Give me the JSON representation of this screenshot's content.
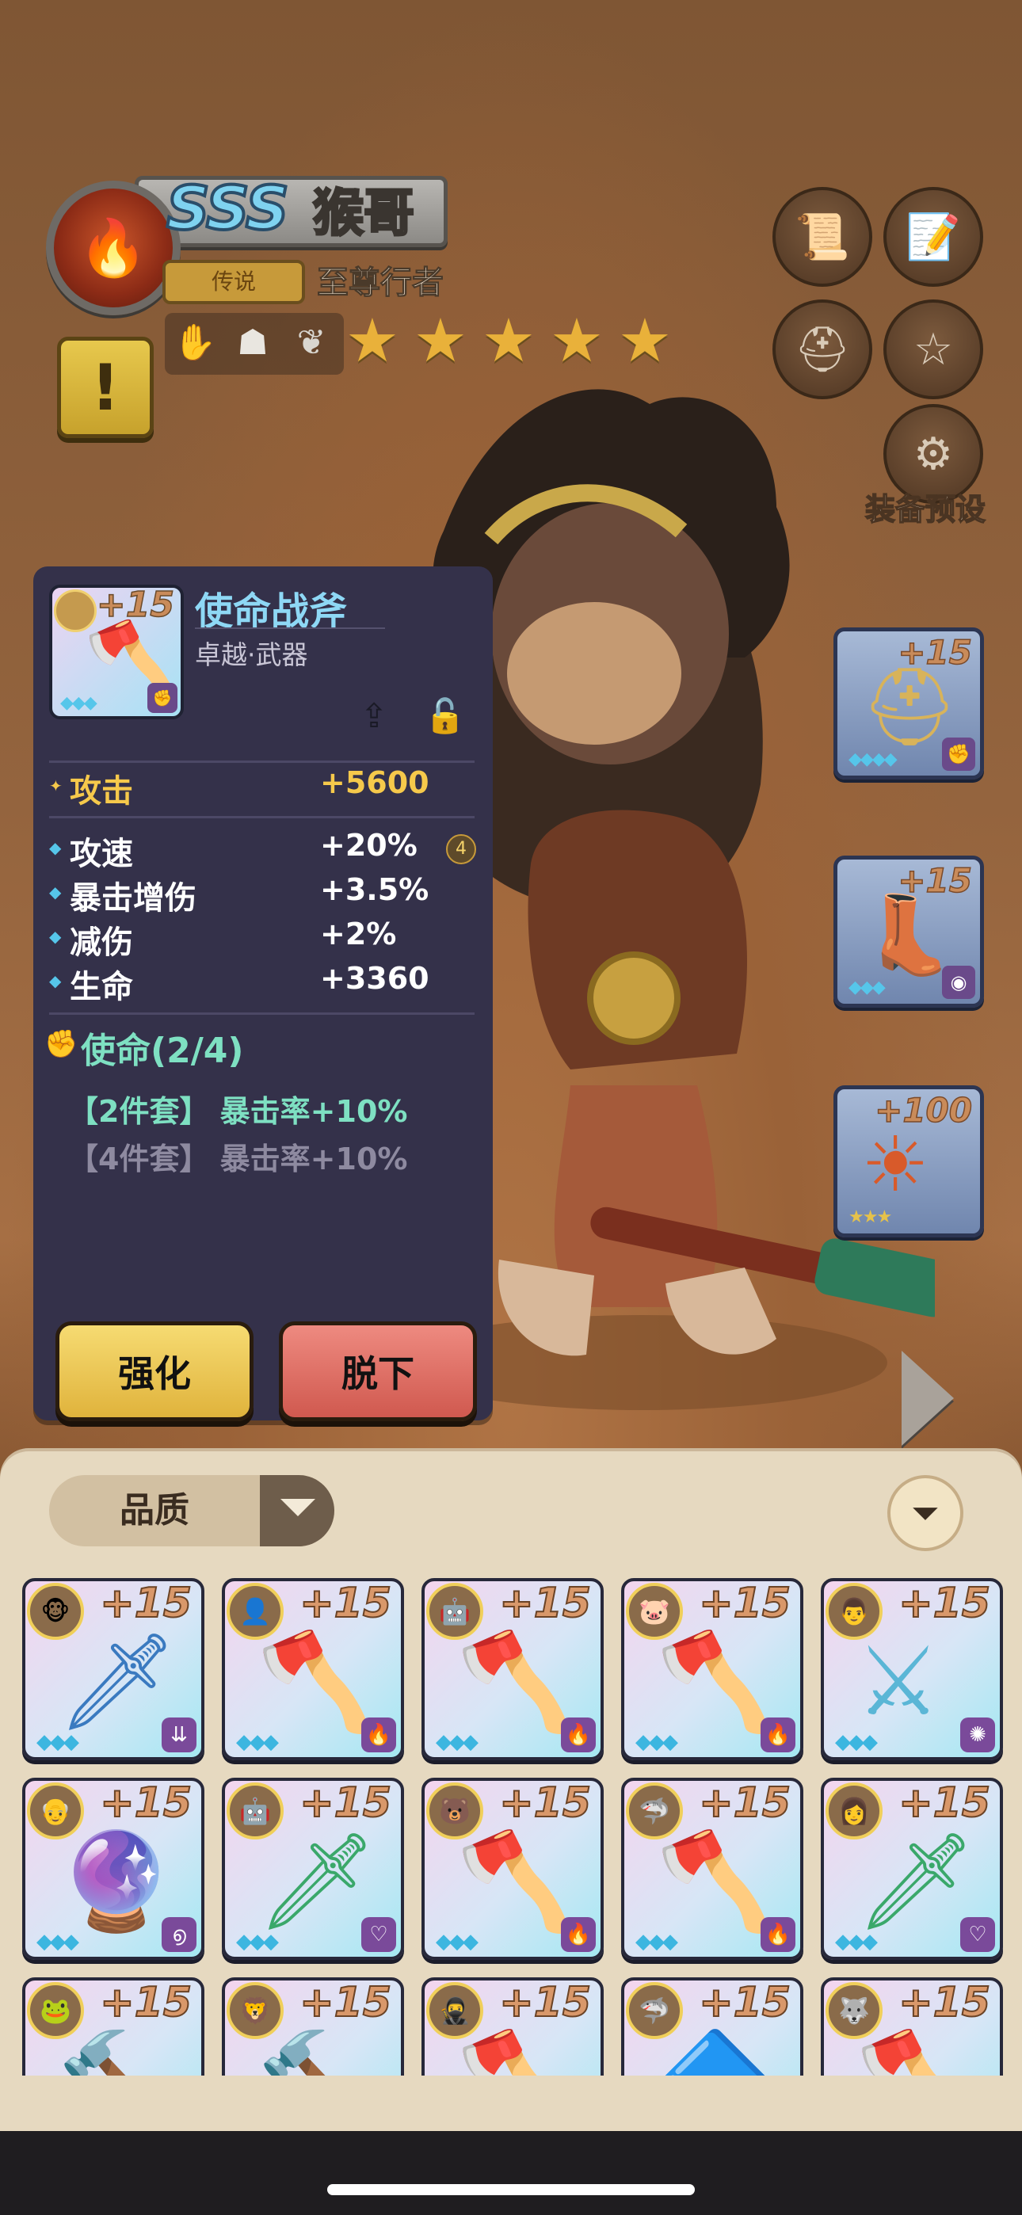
{
  "hero": {
    "grade": "SSS",
    "name": "猴哥",
    "rarity": "传说",
    "title": "至尊行者",
    "element_icon": "flame-icon",
    "traits": [
      "claw-icon",
      "mask-icon",
      "leaf-icon"
    ],
    "stars": 5
  },
  "side_buttons": {
    "preset_label": "装备预设"
  },
  "equipment_slots": [
    {
      "level": "+15",
      "gems": "◆◆◆◆",
      "item": "helmet",
      "tag": "fist"
    },
    {
      "level": "+15",
      "gems": "◆◆◆",
      "item": "boots",
      "tag": "camera"
    },
    {
      "level": "+100",
      "gems": "★★★",
      "item": "relic",
      "tag": ""
    }
  ],
  "detail": {
    "level": "+15",
    "gems": "◆◆◆",
    "name": "使命战斧",
    "type": "卓越·武器",
    "main_stat": {
      "name": "攻击",
      "value": "+5600"
    },
    "stats": [
      {
        "name": "攻速",
        "value": "+20%"
      },
      {
        "name": "暴击增伤",
        "value": "+3.5%"
      },
      {
        "name": "减伤",
        "value": "+2%"
      },
      {
        "name": "生命",
        "value": "+3360"
      }
    ],
    "stat_badge": "4",
    "set_title": "使命(2/4)",
    "set_bonuses": [
      "【2件套】 暴击率+10%",
      "【4件套】 暴击率+10%"
    ],
    "set_active": [
      true,
      false
    ],
    "upgrade_label": "强化",
    "remove_label": "脱下"
  },
  "inventory": {
    "filter_label": "品质",
    "items": [
      {
        "level": "+15",
        "gems": "◆◆◆",
        "avatar": "🐵",
        "art": "🗡",
        "tag": "arrows"
      },
      {
        "level": "+15",
        "gems": "◆◆◆",
        "avatar": "👤",
        "art": "🪓",
        "tag": "flame"
      },
      {
        "level": "+15",
        "gems": "◆◆◆",
        "avatar": "🤖",
        "art": "🪓",
        "tag": "flame"
      },
      {
        "level": "+15",
        "gems": "◆◆◆",
        "avatar": "🐷",
        "art": "🪓",
        "tag": "flame"
      },
      {
        "level": "+15",
        "gems": "◆◆◆",
        "avatar": "👨",
        "art": "⚔",
        "tag": "swirl"
      },
      {
        "level": "+15",
        "gems": "◆◆◆",
        "avatar": "👴",
        "art": "🔮",
        "tag": "spiral"
      },
      {
        "level": "+15",
        "gems": "◆◆◆",
        "avatar": "🤖",
        "art": "🗡",
        "tag": "heart"
      },
      {
        "level": "+15",
        "gems": "◆◆◆",
        "avatar": "🐻",
        "art": "🪓",
        "tag": "flame"
      },
      {
        "level": "+15",
        "gems": "◆◆◆",
        "avatar": "🦈",
        "art": "🪓",
        "tag": "flame"
      },
      {
        "level": "+15",
        "gems": "◆◆◆",
        "avatar": "👩",
        "art": "🗡",
        "tag": "heart"
      },
      {
        "level": "+15",
        "gems": "◆◆◆",
        "avatar": "🐸",
        "art": "🔨",
        "tag": ""
      },
      {
        "level": "+15",
        "gems": "◆◆◆",
        "avatar": "🦁",
        "art": "🔨",
        "tag": ""
      },
      {
        "level": "+15",
        "gems": "◆◆◆",
        "avatar": "🥷",
        "art": "🪓",
        "tag": ""
      },
      {
        "level": "+15",
        "gems": "◆◆◆",
        "avatar": "🦈",
        "art": "🔷",
        "tag": ""
      },
      {
        "level": "+15",
        "gems": "◆◆◆",
        "avatar": "🐺",
        "art": "🪓",
        "tag": ""
      }
    ]
  },
  "colors": {
    "panel_bg": "#34314a",
    "item_name": "#8ed8f5",
    "main_stat": "#f6c94b",
    "set_active": "#7ee0c2",
    "set_inactive": "#8e8aa0"
  }
}
